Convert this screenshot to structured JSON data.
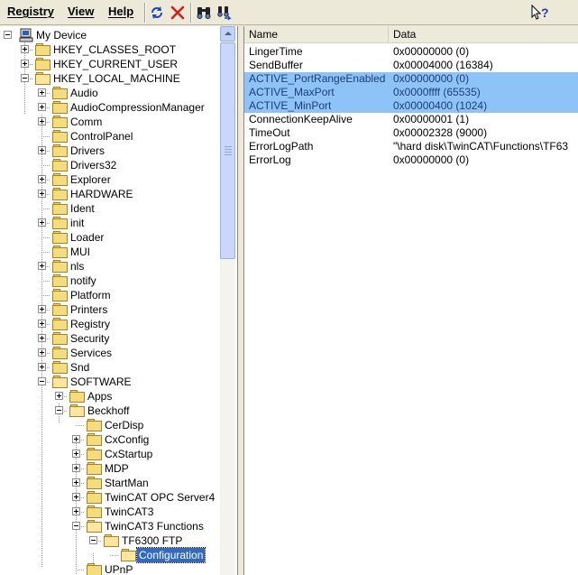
{
  "menu": {
    "registry": "Registry",
    "view": "View",
    "help": "Help"
  },
  "toolbar_icons": [
    "refresh-icon",
    "delete-icon",
    "find-icon",
    "find-next-icon",
    "context-help-icon"
  ],
  "tree": {
    "root": "My Device",
    "items": [
      {
        "label": "HKEY_CLASSES_ROOT"
      },
      {
        "label": "HKEY_CURRENT_USER"
      },
      {
        "label": "HKEY_LOCAL_MACHINE"
      },
      {
        "label": "Audio"
      },
      {
        "label": "AudioCompressionManager"
      },
      {
        "label": "Comm"
      },
      {
        "label": "ControlPanel"
      },
      {
        "label": "Drivers"
      },
      {
        "label": "Drivers32"
      },
      {
        "label": "Explorer"
      },
      {
        "label": "HARDWARE"
      },
      {
        "label": "Ident"
      },
      {
        "label": "init"
      },
      {
        "label": "Loader"
      },
      {
        "label": "MUI"
      },
      {
        "label": "nls"
      },
      {
        "label": "notify"
      },
      {
        "label": "Platform"
      },
      {
        "label": "Printers"
      },
      {
        "label": "Registry"
      },
      {
        "label": "Security"
      },
      {
        "label": "Services"
      },
      {
        "label": "Snd"
      },
      {
        "label": "SOFTWARE"
      },
      {
        "label": "Apps"
      },
      {
        "label": "Beckhoff"
      },
      {
        "label": "CerDisp"
      },
      {
        "label": "CxConfig"
      },
      {
        "label": "CxStartup"
      },
      {
        "label": "MDP"
      },
      {
        "label": "StartMan"
      },
      {
        "label": "TwinCAT OPC Server4"
      },
      {
        "label": "TwinCAT3"
      },
      {
        "label": "TwinCAT3 Functions"
      },
      {
        "label": "TF6300 FTP"
      },
      {
        "label": "Configuration"
      },
      {
        "label": "UPnP"
      }
    ]
  },
  "list": {
    "columns": {
      "name": "Name",
      "data": "Data"
    },
    "rows": [
      {
        "name": "LingerTime",
        "data": "0x00000000 (0)",
        "selected": false
      },
      {
        "name": "SendBuffer",
        "data": "0x00004000 (16384)",
        "selected": false
      },
      {
        "name": "ACTIVE_PortRangeEnabled",
        "data": "0x00000000 (0)",
        "selected": true
      },
      {
        "name": "ACTIVE_MaxPort",
        "data": "0x0000ffff (65535)",
        "selected": true
      },
      {
        "name": "ACTIVE_MinPort",
        "data": "0x00000400 (1024)",
        "selected": true
      },
      {
        "name": "ConnectionKeepAlive",
        "data": "0x00000001 (1)",
        "selected": false
      },
      {
        "name": "TimeOut",
        "data": "0x00002328 (9000)",
        "selected": false
      },
      {
        "name": "ErrorLogPath",
        "data": "\"\\hard disk\\TwinCAT\\Functions\\TF63",
        "selected": false
      },
      {
        "name": "ErrorLog",
        "data": "0x00000000 (0)",
        "selected": false
      }
    ]
  }
}
